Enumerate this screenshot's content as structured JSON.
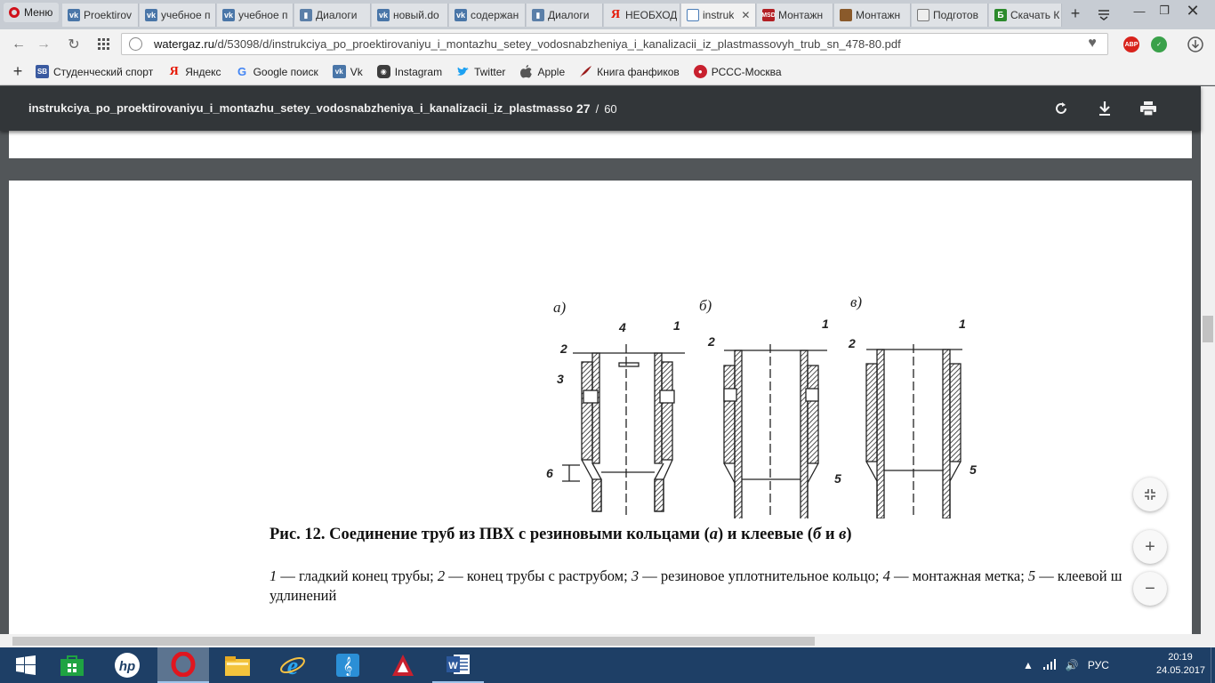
{
  "browser": {
    "menu_label": "Меню",
    "tabs": [
      {
        "label": "Proektirov",
        "icon": "vk-icon"
      },
      {
        "label": "учебное п",
        "icon": "vk-icon"
      },
      {
        "label": "учебное п",
        "icon": "vk-icon"
      },
      {
        "label": "Диалоги",
        "icon": "dialog-icon"
      },
      {
        "label": "новый.do",
        "icon": "vk-icon"
      },
      {
        "label": "содержан",
        "icon": "vk-icon"
      },
      {
        "label": "Диалоги",
        "icon": "dialog-icon"
      },
      {
        "label": "НЕОБХОД",
        "icon": "yandex-icon"
      },
      {
        "label": "instruk",
        "icon": "pdf-icon",
        "active": true
      },
      {
        "label": "Монтажн",
        "icon": "site-icon"
      },
      {
        "label": "Монтажн",
        "icon": "site-icon"
      },
      {
        "label": "Подготов",
        "icon": "doc-icon"
      },
      {
        "label": "Скачать К",
        "icon": "site-icon"
      }
    ],
    "url_host": "watergaz.ru",
    "url_path": "/d/53098/d/instrukciya_po_proektirovaniyu_i_montazhu_setey_vodosnabzheniya_i_kanalizacii_iz_plastmassovyh_trub_sn_478-80.pdf",
    "extensions": [
      "ABP",
      "shield"
    ],
    "bookmarks": [
      {
        "label": "Студенческий спорт",
        "icon": "sport-icon"
      },
      {
        "label": "Яндекс",
        "icon": "yandex-icon"
      },
      {
        "label": "Google поиск",
        "icon": "google-icon"
      },
      {
        "label": "Vk",
        "icon": "vk-icon"
      },
      {
        "label": "Instagram",
        "icon": "instagram-icon"
      },
      {
        "label": "Twitter",
        "icon": "twitter-icon"
      },
      {
        "label": "Apple",
        "icon": "apple-icon"
      },
      {
        "label": "Книга фанфиков",
        "icon": "feather-icon"
      },
      {
        "label": "РССС-Москва",
        "icon": "rsss-icon"
      }
    ]
  },
  "pdf": {
    "title": "instrukciya_po_proektirovaniyu_i_montazhu_setey_vodosnabzheniya_i_kanalizacii_iz_plastmasso...",
    "current_page": "27",
    "separator": "/",
    "total_pages": "60",
    "figure": {
      "panel_labels": [
        "а)",
        "б)",
        "в)"
      ],
      "callouts": [
        "1",
        "2",
        "3",
        "4",
        "5",
        "6"
      ],
      "caption_start": "Рис. 12. Соединение труб из ПВХ с резиновыми кольцами (",
      "caption_a": "а",
      "caption_mid": ") и клеевые (",
      "caption_b": "б",
      "caption_and": " и ",
      "caption_v": "в",
      "caption_end": ")",
      "legend_n1": "1",
      "legend_t1": " — гладкий конец трубы; ",
      "legend_n2": "2",
      "legend_t2": " — конец трубы с раструбом; ",
      "legend_n3": "3",
      "legend_t3": " — резиновое уплотнительное кольцо; ",
      "legend_n4": "4",
      "legend_t4": " — монтажная метка; ",
      "legend_n5": "5",
      "legend_t5": " — клеевой ш",
      "legend_line2": "удлинений"
    }
  },
  "taskbar": {
    "apps": [
      "windows-start",
      "store",
      "hp",
      "opera",
      "file-explorer",
      "internet-explorer",
      "music",
      "autocad",
      "word"
    ],
    "language": "РУС",
    "time": "20:19",
    "date": "24.05.2017"
  }
}
